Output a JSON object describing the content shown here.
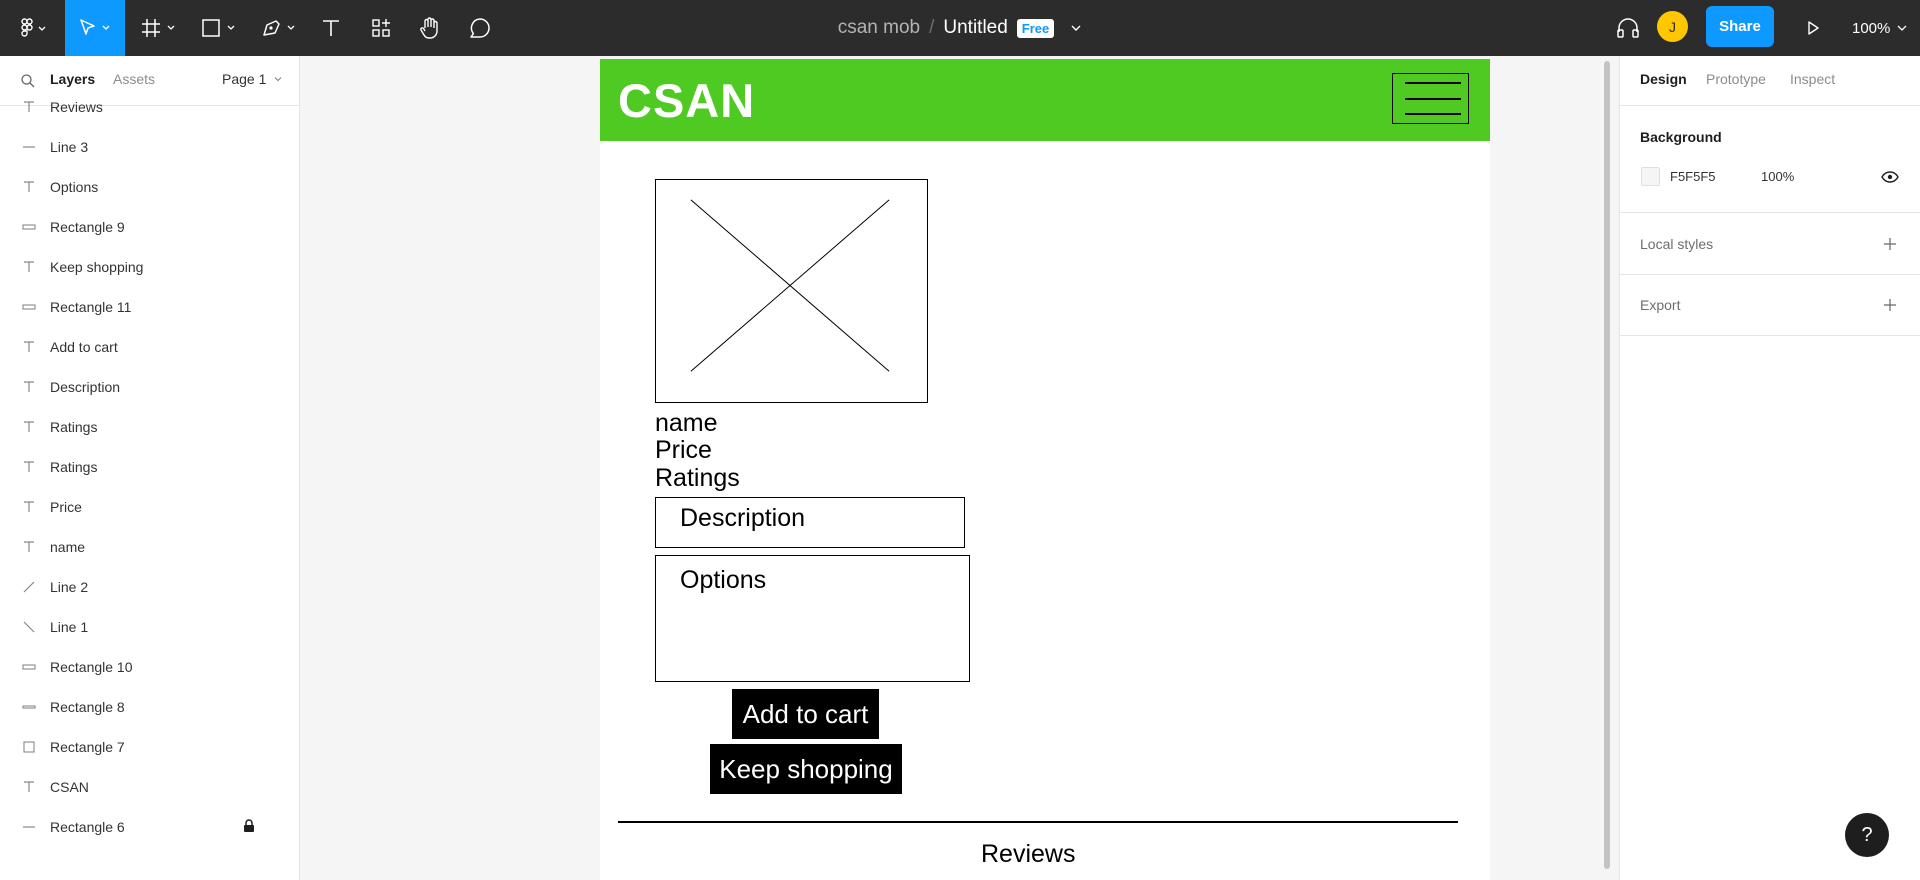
{
  "toolbar": {
    "project": "csan mob",
    "separator": "/",
    "file": "Untitled",
    "plan_badge": "Free",
    "avatar_initial": "J",
    "share_label": "Share",
    "zoom": "100%"
  },
  "left_panel": {
    "tabs": {
      "layers": "Layers",
      "assets": "Assets"
    },
    "page": "Page 1",
    "layers": [
      {
        "label": "Reviews",
        "icon": "text-icon"
      },
      {
        "label": "Line 3",
        "icon": "line-horizontal-icon"
      },
      {
        "label": "Options",
        "icon": "text-icon"
      },
      {
        "label": "Rectangle 9",
        "icon": "rectangle-thin-icon"
      },
      {
        "label": "Keep shopping",
        "icon": "text-icon"
      },
      {
        "label": "Rectangle 11",
        "icon": "rectangle-thin-icon"
      },
      {
        "label": "Add to cart",
        "icon": "text-icon"
      },
      {
        "label": "Description",
        "icon": "text-icon"
      },
      {
        "label": "Ratings",
        "icon": "text-icon"
      },
      {
        "label": "Ratings",
        "icon": "text-icon"
      },
      {
        "label": "Price",
        "icon": "text-icon"
      },
      {
        "label": "name",
        "icon": "text-icon"
      },
      {
        "label": "Line 2",
        "icon": "line-diagonal-up-icon"
      },
      {
        "label": "Line 1",
        "icon": "line-diagonal-down-icon"
      },
      {
        "label": "Rectangle 10",
        "icon": "rectangle-thin-icon"
      },
      {
        "label": "Rectangle 8",
        "icon": "rectangle-bar-icon"
      },
      {
        "label": "Rectangle 7",
        "icon": "rectangle-square-icon"
      },
      {
        "label": "CSAN",
        "icon": "text-icon"
      },
      {
        "label": "Rectangle 6",
        "icon": "line-horizontal-icon",
        "locked": true
      }
    ]
  },
  "canvas": {
    "logo": "CSAN",
    "product_name": "name",
    "price": "Price",
    "ratings": "Ratings",
    "description": "Description",
    "options": "Options",
    "add_to_cart": "Add to cart",
    "keep_shopping": "Keep shopping",
    "reviews": "Reviews",
    "header_color": "#4fca23"
  },
  "right_panel": {
    "tabs": {
      "design": "Design",
      "prototype": "Prototype",
      "inspect": "Inspect"
    },
    "background_heading": "Background",
    "background_hex": "F5F5F5",
    "background_opacity": "100%",
    "local_styles": "Local styles",
    "export": "Export"
  },
  "help": "?"
}
